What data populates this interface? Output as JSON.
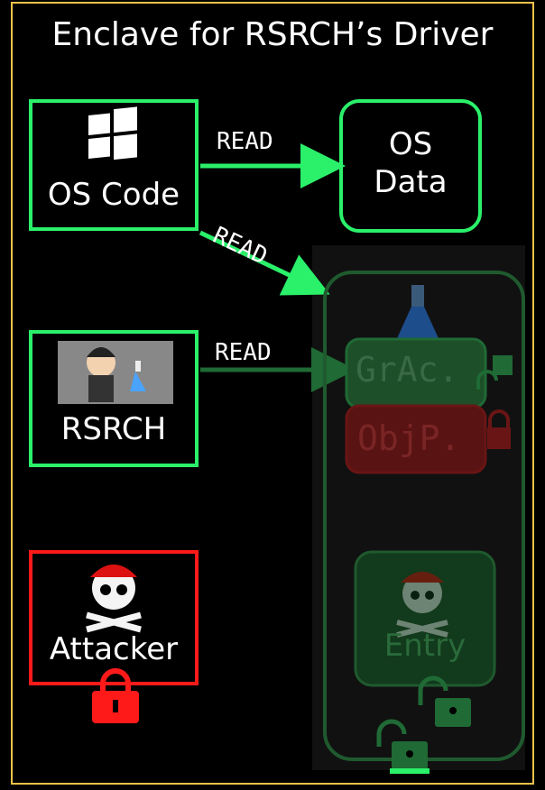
{
  "title": "Enclave for RSRCH’s Driver",
  "nodes": {
    "os_code": "OS Code",
    "os_data_line1": "OS",
    "os_data_line2": "Data",
    "rsrch": "RSRCH",
    "attacker": "Attacker",
    "grac": "GrAc.",
    "objp": "ObjP.",
    "entry": "Entry"
  },
  "edges": {
    "read_top": "READ",
    "read_diag": "READ",
    "read_mid": "READ"
  },
  "colors": {
    "green": "#2af06a",
    "red": "#ff1a1a",
    "frame": "#f2c24a",
    "dim_green": "#1f5a2e",
    "dim_red": "#6a1515"
  },
  "icons": {
    "os_code": "windows-logo-icon",
    "rsrch": "researcher-with-flask-icon",
    "attacker": "pirate-skull-icon",
    "attacker_lock": "locked-padlock-icon",
    "enclave_flask": "flask-icon",
    "entry_pirate": "pirate-skull-icon",
    "unlocked": "unlocked-padlock-icon"
  }
}
